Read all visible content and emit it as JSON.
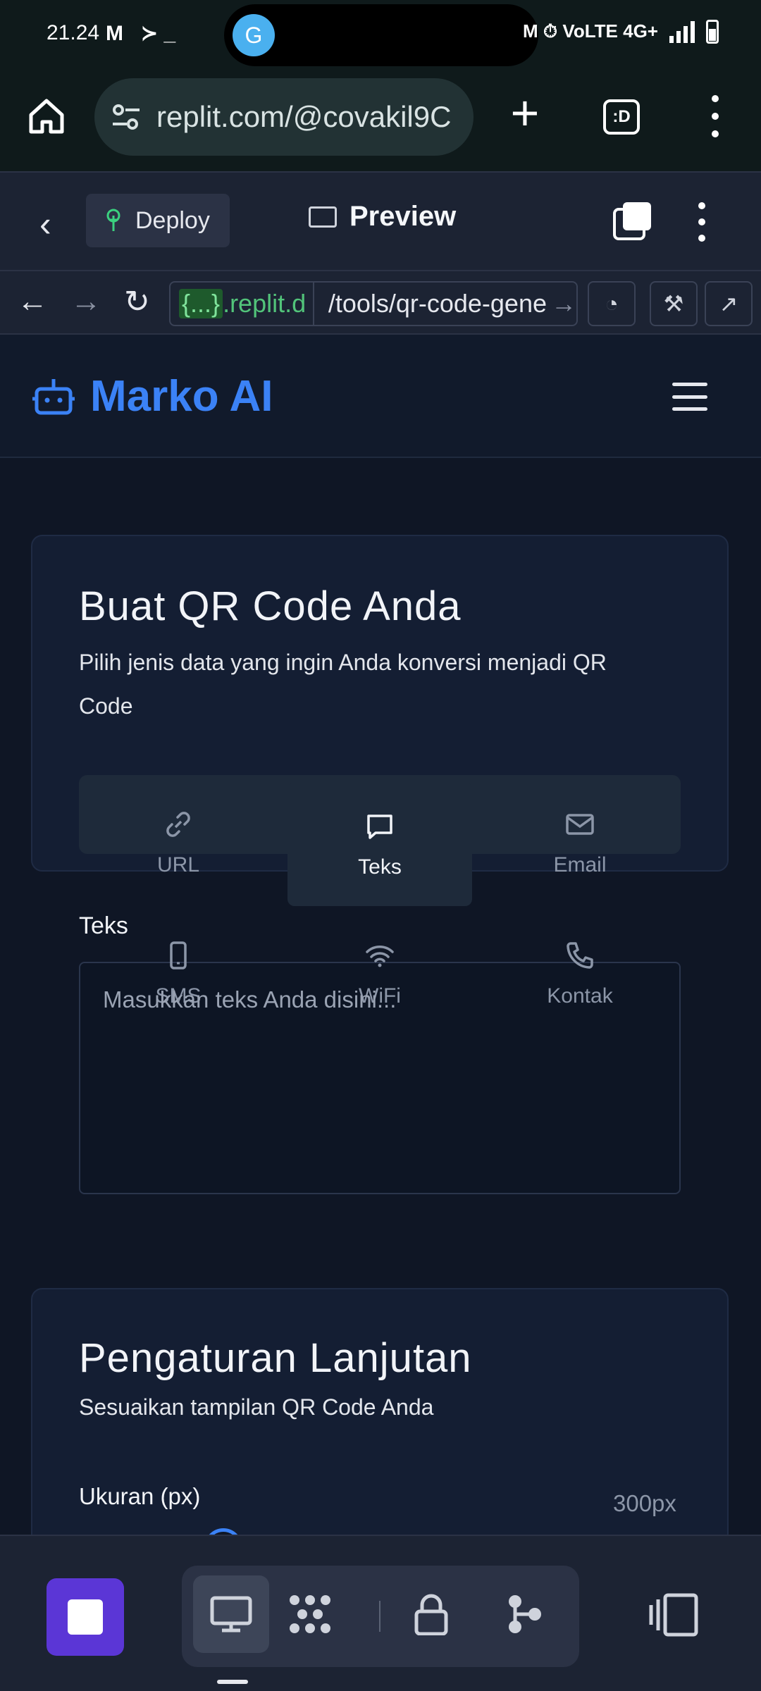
{
  "status_bar": {
    "time": "21.24",
    "left_icons": "M ≻_",
    "notch_avatar": "G",
    "right_icons": "M ⏱ VoLTE 4G+",
    "icon_names": [
      "gmail-icon",
      "terminal-icon",
      "gmail-icon",
      "alarm-icon",
      "volte-icon",
      "signal-icon",
      "battery-icon"
    ]
  },
  "browser": {
    "url": "replit.com/@covakil9C",
    "tab_count_label": ":D"
  },
  "replit": {
    "deploy_label": "Deploy",
    "preview_label": "Preview",
    "nav_domain_brace": "{...}",
    "nav_domain": ".replit.d",
    "nav_path": "/tools/qr-code-gene"
  },
  "site": {
    "brand": "Marko AI",
    "create_card": {
      "title": "Buat QR Code Anda",
      "subtitle_line1": "Pilih jenis data yang ingin Anda konversi menjadi QR",
      "subtitle_line2": "Code",
      "tabs": [
        {
          "label": "URL",
          "icon": "link-icon"
        },
        {
          "label": "Teks",
          "icon": "message-icon"
        },
        {
          "label": "Email",
          "icon": "mail-icon"
        },
        {
          "label": "SMS",
          "icon": "phone-icon"
        },
        {
          "label": "WiFi",
          "icon": "wifi-icon"
        },
        {
          "label": "Kontak",
          "icon": "contact-phone-icon"
        }
      ],
      "active_tab": "Teks",
      "text_label": "Teks",
      "text_placeholder": "Masukkan teks Anda disini..."
    },
    "advanced_card": {
      "title": "Pengaturan Lanjutan",
      "subtitle": "Sesuaikan tampilan QR Code Anda",
      "size_label": "Ukuran (px)",
      "size_value": "300px"
    }
  },
  "colors": {
    "accent": "#3b82f6",
    "stop_button": "#5b36d6",
    "page_bg": "#0f1625",
    "card_bg": "#141e33"
  }
}
